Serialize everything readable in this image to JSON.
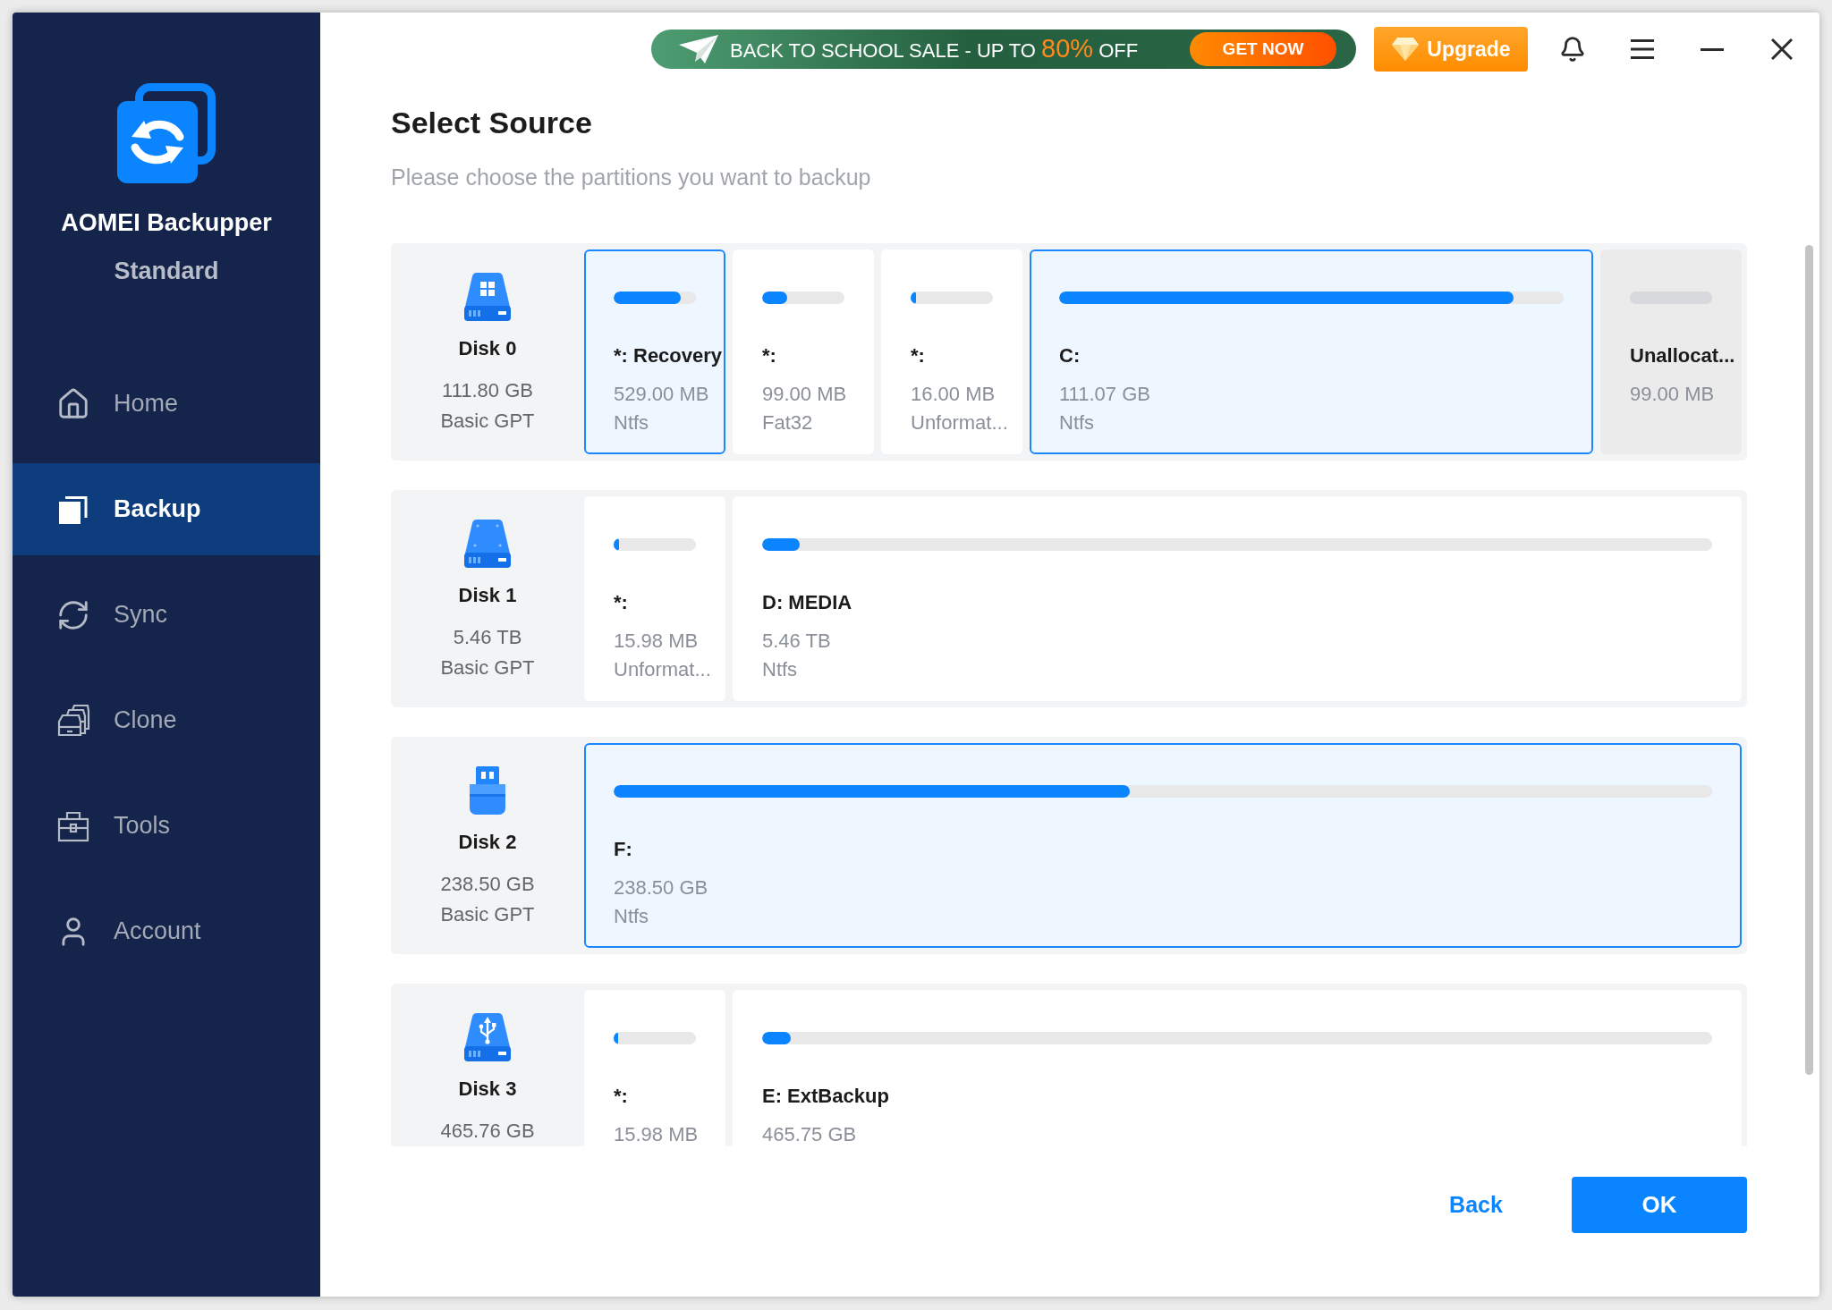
{
  "sidebar": {
    "app_name": "AOMEI Backupper",
    "edition": "Standard",
    "items": [
      {
        "label": "Home",
        "selected": false
      },
      {
        "label": "Backup",
        "selected": true
      },
      {
        "label": "Sync",
        "selected": false
      },
      {
        "label": "Clone",
        "selected": false
      },
      {
        "label": "Tools",
        "selected": false
      },
      {
        "label": "Account",
        "selected": false
      }
    ]
  },
  "top_bar": {
    "promo": {
      "text_before": "BACK TO SCHOOL SALE - UP TO",
      "highlight": "80%",
      "text_after": "OFF",
      "button": "GET NOW"
    },
    "upgrade_button": "Upgrade"
  },
  "page": {
    "title": "Select Source",
    "subtitle": "Please choose the partitions you want to backup"
  },
  "disks": [
    {
      "kind": "system_hdd",
      "name": "Disk 0",
      "size": "111.80 GB",
      "style": "Basic GPT",
      "partitions": [
        {
          "kind": "partition",
          "name": "*: Recovery",
          "size": "529.00 MB",
          "file_system": "Ntfs",
          "level": 0.82,
          "selected": true
        },
        {
          "kind": "partition",
          "name": "*:",
          "size": "99.00 MB",
          "file_system": "Fat32",
          "level": 0.3,
          "selected": false
        },
        {
          "kind": "partition",
          "name": "*:",
          "size": "16.00 MB",
          "file_system": "Unformat...",
          "level": 0.07,
          "selected": false
        },
        {
          "kind": "partition",
          "name": "C:",
          "size": "111.07 GB",
          "file_system": "Ntfs",
          "level": 0.9,
          "selected": true
        },
        {
          "kind": "unallocated",
          "name": "Unallocat...",
          "size": "99.00 MB",
          "selected": false
        }
      ]
    },
    {
      "kind": "hdd",
      "name": "Disk 1",
      "size": "5.46 TB",
      "style": "Basic GPT",
      "partitions": [
        {
          "kind": "partition",
          "name": "*:",
          "size": "15.98 MB",
          "file_system": "Unformat...",
          "level": 0.07,
          "selected": false
        },
        {
          "kind": "partition",
          "name": "D: MEDIA",
          "size": "5.46 TB",
          "file_system": "Ntfs",
          "level": 0.04,
          "selected": false
        }
      ]
    },
    {
      "kind": "usb_flash",
      "name": "Disk 2",
      "size": "238.50 GB",
      "style": "Basic GPT",
      "partitions": [
        {
          "kind": "partition",
          "name": "F:",
          "size": "238.50 GB",
          "file_system": "Ntfs",
          "level": 0.47,
          "selected": true
        }
      ]
    },
    {
      "kind": "usb_hdd",
      "name": "Disk 3",
      "size": "465.76 GB",
      "partitions": [
        {
          "kind": "partition",
          "name": "*:",
          "size": "15.98 MB",
          "level": 0.05,
          "selected": false
        },
        {
          "kind": "partition",
          "name": "E: ExtBackup",
          "size": "465.75 GB",
          "level": 0.03,
          "selected": false
        }
      ]
    }
  ],
  "buttons": {
    "back": "Back",
    "ok": "OK"
  }
}
